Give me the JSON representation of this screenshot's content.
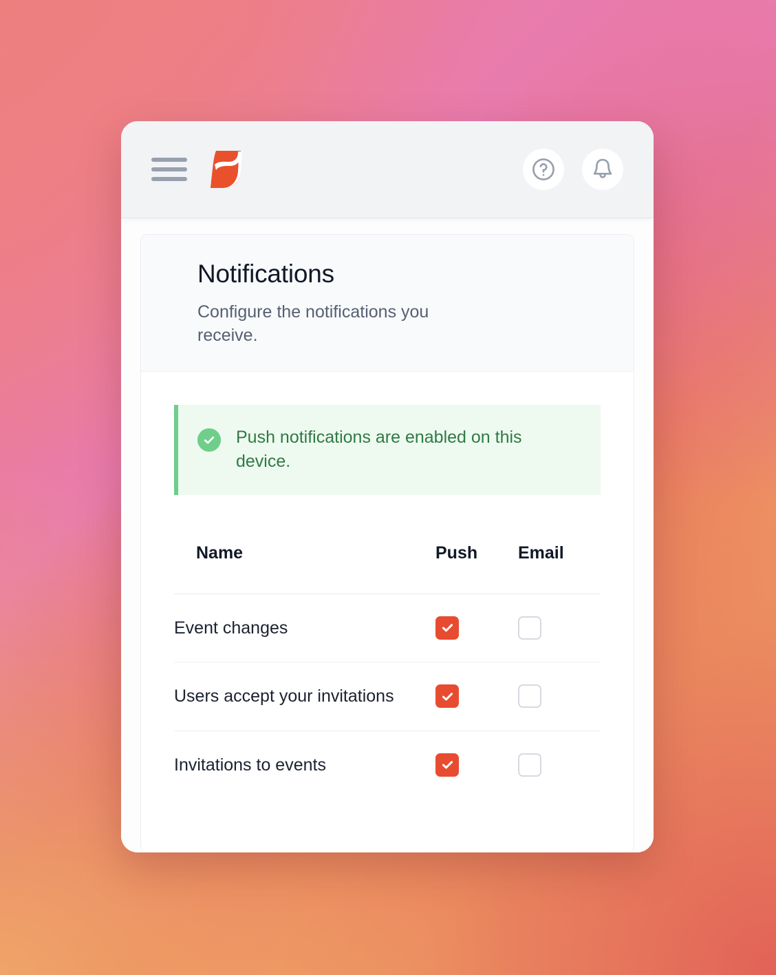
{
  "theme": {
    "accent": "#e84c30",
    "success": "#6ece8a",
    "success_text": "#2f7a45",
    "success_bg": "#eefaf0",
    "header_bg": "#f1f3f5",
    "icon_gray": "#97a0ae"
  },
  "header": {
    "menu_icon": "hamburger-menu-icon",
    "logo_icon": "brand-logo-icon",
    "help_icon": "help-circle-icon",
    "bell_icon": "bell-icon"
  },
  "card": {
    "title": "Notifications",
    "subtitle": "Configure the notifications you receive."
  },
  "alert": {
    "icon": "check-circle-icon",
    "message": "Push notifications are enabled on this device."
  },
  "table": {
    "columns": {
      "name": "Name",
      "push": "Push",
      "email": "Email"
    },
    "rows": [
      {
        "name": "Event changes",
        "push": true,
        "email": false
      },
      {
        "name": "Users accept your invitations",
        "push": true,
        "email": false
      },
      {
        "name": "Invitations to events",
        "push": true,
        "email": false
      }
    ]
  }
}
